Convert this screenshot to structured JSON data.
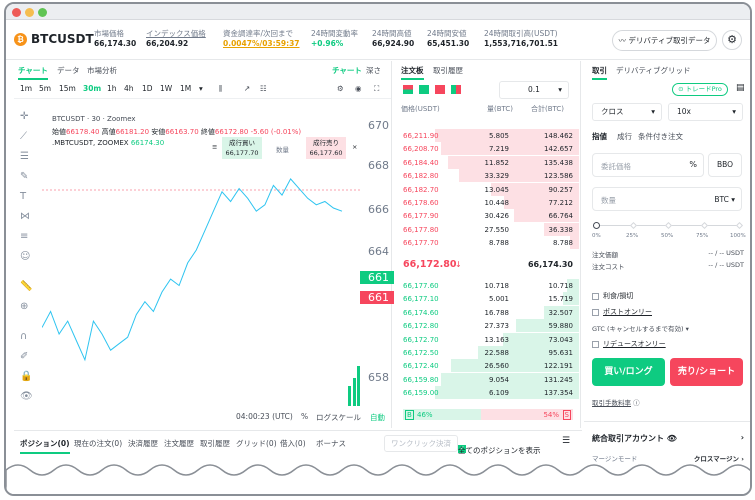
{
  "header": {
    "symbol": "BTCUSDT",
    "stats": [
      {
        "label": "市場価格",
        "value": "66,174.30"
      },
      {
        "label": "インデックス価格",
        "value": "66,204.92"
      },
      {
        "label": "資金調達率/次回まで",
        "value": "0.0047%/03:59:37"
      },
      {
        "label": "24時間変動率",
        "value": "+0.96%"
      },
      {
        "label": "24時間高値",
        "value": "66,924.90"
      },
      {
        "label": "24時間安値",
        "value": "65,451.30"
      },
      {
        "label": "24時間取引高(USDT)",
        "value": "1,553,716,701.51"
      }
    ],
    "derivatives_button": "デリバティブ取引データ"
  },
  "chart": {
    "tabs": [
      "チャート",
      "データ",
      "市場分析"
    ],
    "right_tabs": [
      "チャート",
      "深さ"
    ],
    "timeframes": [
      "1m",
      "5m",
      "15m",
      "30m",
      "1h",
      "4h",
      "1D",
      "1W",
      "1M"
    ],
    "info_line": "BTCUSDT · 30 · Zoomex",
    "ohlc": {
      "open_label": "始値",
      "open": "66178.40",
      "high_label": "高値",
      "high": "66181.20",
      "low_label": "安値",
      "low": "66163.70",
      "close_label": "終値",
      "close": "66172.80",
      "change": "-5.60 (-0.01%)"
    },
    "mark_line": ".MBTCUSDT, ZOOMEX",
    "mark_value": "66174.30",
    "buy_market": {
      "label": "成行買い",
      "value": "66,177.70"
    },
    "qty_label": "数量",
    "sell_market": {
      "label": "成行売り",
      "value": "66,177.60"
    },
    "price_axis": [
      "670",
      "668",
      "666",
      "664",
      "661",
      "661",
      "658"
    ],
    "footer_time": "04:00:23 (UTC)",
    "footer_pct": "%",
    "footer_log": "ログスケール",
    "footer_auto": "自動"
  },
  "chart_data": {
    "type": "line",
    "series": [
      {
        "values": [
          66400,
          66450,
          66380,
          66420,
          66360,
          66300,
          66420,
          66380,
          66330,
          66350,
          66370,
          66440,
          66480,
          66450,
          66510,
          66550,
          66530,
          66600,
          66640,
          66700,
          66760,
          66820,
          66790,
          66830,
          66800,
          66760,
          66780,
          66840,
          66810,
          66860,
          66830,
          66800,
          66780,
          66790,
          66770,
          66760
        ]
      }
    ],
    "ylim": [
      66500,
      67000
    ]
  },
  "orderbook": {
    "tabs": [
      "注文板",
      "取引履歴"
    ],
    "precision": "0.1",
    "headers": [
      "価格(USDT)",
      "量(BTC)",
      "合計(BTC)"
    ],
    "asks": [
      {
        "price": "66,211.90",
        "qty": "5.805",
        "total": "148.462",
        "depth": 1.0
      },
      {
        "price": "66,208.70",
        "qty": "7.219",
        "total": "142.657",
        "depth": 0.96
      },
      {
        "price": "66,184.40",
        "qty": "11.852",
        "total": "135.438",
        "depth": 0.91
      },
      {
        "price": "66,182.80",
        "qty": "33.329",
        "total": "123.586",
        "depth": 0.83
      },
      {
        "price": "66,182.70",
        "qty": "13.045",
        "total": "90.257",
        "depth": 0.61
      },
      {
        "price": "66,178.60",
        "qty": "10.448",
        "total": "77.212",
        "depth": 0.52
      },
      {
        "price": "66,177.90",
        "qty": "30.426",
        "total": "66.764",
        "depth": 0.45
      },
      {
        "price": "66,177.80",
        "qty": "27.550",
        "total": "36.338",
        "depth": 0.24
      },
      {
        "price": "66,177.70",
        "qty": "8.788",
        "total": "8.788",
        "depth": 0.06
      }
    ],
    "last_price": "66,172.80",
    "mark_price": "66,174.30",
    "bids": [
      {
        "price": "66,177.60",
        "qty": "10.718",
        "total": "10.718",
        "depth": 0.08
      },
      {
        "price": "66,177.10",
        "qty": "5.001",
        "total": "15.719",
        "depth": 0.11
      },
      {
        "price": "66,174.60",
        "qty": "16.788",
        "total": "32.507",
        "depth": 0.24
      },
      {
        "price": "66,172.80",
        "qty": "27.373",
        "total": "59.880",
        "depth": 0.44
      },
      {
        "price": "66,172.70",
        "qty": "13.163",
        "total": "73.043",
        "depth": 0.53
      },
      {
        "price": "66,172.50",
        "qty": "22.588",
        "total": "95.631",
        "depth": 0.7
      },
      {
        "price": "66,172.40",
        "qty": "26.560",
        "total": "122.191",
        "depth": 0.89
      },
      {
        "price": "66,159.80",
        "qty": "9.054",
        "total": "131.245",
        "depth": 0.96
      },
      {
        "price": "66,159.00",
        "qty": "6.109",
        "total": "137.354",
        "depth": 1.0
      }
    ],
    "buy_ratio": "46%",
    "sell_ratio": "54%",
    "b_tag": "B",
    "s_tag": "S"
  },
  "trade": {
    "tabs": [
      "取引",
      "デリバティブグリッド"
    ],
    "pro_button": "トレードPro",
    "margin_mode": "クロス",
    "leverage": "10x",
    "order_types": [
      "指値",
      "成行",
      "条件付き注文"
    ],
    "price_placeholder": "委託価格",
    "bbo": "BBO",
    "qty_placeholder": "数量",
    "qty_unit": "BTC",
    "slider_marks": [
      "0%",
      "25%",
      "50%",
      "75%",
      "100%"
    ],
    "cost_label": "注文価額",
    "cost_value": "-- / -- USDT",
    "margin_label": "注文コスト",
    "margin_value": "-- / -- USDT",
    "tpsl": "利食/損切",
    "post_only": "ポストオンリー",
    "tif": "GTC (キャンセルするまで有効)",
    "reduce_only": "リデュースオンリー",
    "buy_label": "買い/ロング",
    "sell_label": "売り/ショート",
    "fee_label": "取引手数料率",
    "account_label": "統合取引アカウント",
    "margin_mode_label": "マージンモード",
    "margin_mode_value": "クロスマージン"
  },
  "bottom": {
    "tabs": [
      "ポジション(0)",
      "現在の注文(0)",
      "決済履歴",
      "注文履歴",
      "取引履歴",
      "グリッド(0)",
      "借入(0)",
      "ボーナス"
    ],
    "one_click": "ワンクリック決済",
    "show_all": "全てのポジションを表示"
  }
}
